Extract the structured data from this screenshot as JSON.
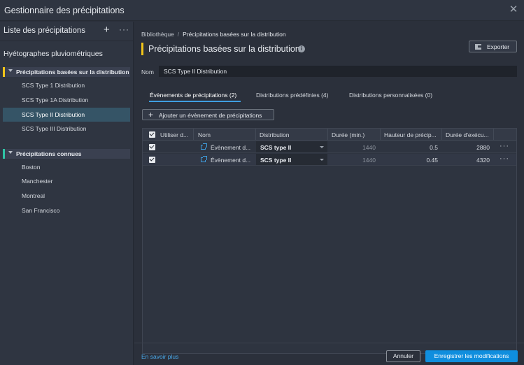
{
  "window": {
    "title": "Gestionnaire des précipitations"
  },
  "left_panel": {
    "title": "Liste des précipitations",
    "section_heading": "Hyétographes pluviométriques",
    "groups": [
      {
        "label": "Précipitations basées sur la distribution",
        "accent": "#f0c419",
        "items": [
          "SCS Type 1 Distribution",
          "SCS Type 1A Distribution",
          "SCS Type II Distribution",
          "SCS Type III Distribution"
        ],
        "selected": "SCS Type II Distribution"
      },
      {
        "label": "Précipitations connues",
        "accent": "#2ec4a5",
        "items": [
          "Boston",
          "Manchester",
          "Montreal",
          "San Francisco"
        ]
      }
    ]
  },
  "main": {
    "breadcrumb": {
      "root": "Bibliothèque",
      "separator": "/",
      "current": "Précipitations basées sur la distribution"
    },
    "title": "Précipitations basées sur la distribution",
    "export_label": "Exporter",
    "name_label": "Nom",
    "name_value": "SCS Type II Distribution",
    "tabs": [
      {
        "label": "Évènements de précipitations (2)",
        "active": true
      },
      {
        "label": "Distributions prédéfinies (4)",
        "active": false
      },
      {
        "label": "Distributions personnalisées (0)",
        "active": false
      }
    ],
    "add_event_label": "Ajouter un évènement de précipitations",
    "table": {
      "headers": [
        "Utiliser d...",
        "Nom",
        "Distribution",
        "Durée (min.)",
        "Hauteur de précip...",
        "Durée d'exécu..."
      ],
      "rows": [
        {
          "use": true,
          "name": "Évènement d...",
          "distribution": "SCS type II",
          "duration": "1440",
          "depth": "0.5",
          "run_duration": "2880"
        },
        {
          "use": true,
          "name": "Évènement d...",
          "distribution": "SCS type II",
          "duration": "1440",
          "depth": "0.45",
          "run_duration": "4320"
        }
      ]
    }
  },
  "footer": {
    "learn_more": "En savoir plus",
    "cancel_label": "Annuler",
    "save_label": "Enregistrer les modifications"
  },
  "colors": {
    "accent_blue": "#0f8ede",
    "link_blue": "#4aa8e8",
    "selection": "#355466"
  }
}
